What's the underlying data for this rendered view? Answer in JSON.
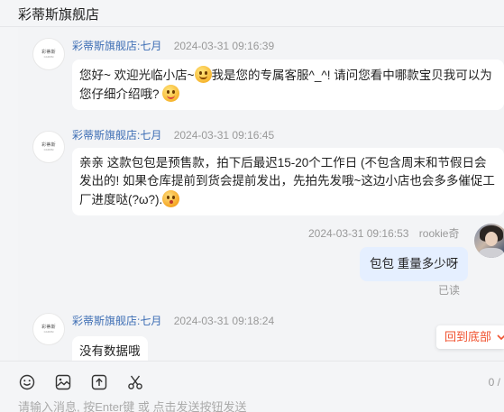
{
  "header": {
    "title": "彩蒂斯旗舰店"
  },
  "shop_avatar": {
    "logo_text": "彩蒂斯",
    "logo_sub": "CAIDISI"
  },
  "messages": [
    {
      "sender": "彩蒂斯旗舰店:七月",
      "time": "2024-03-31 09:16:39",
      "text_a": "您好~ 欢迎光临小店~",
      "text_b": "我是您的专属客服^_^! 请问您看中哪款宝贝我可以为您仔细介绍哦?",
      "emoji_a": "dizzy-face-emoji-icon",
      "emoji_b": "tongue-face-emoji-icon"
    },
    {
      "sender": "彩蒂斯旗舰店:七月",
      "time": "2024-03-31 09:16:45",
      "text": "亲亲 这款包包是预售款，拍下后最迟15-20个工作日 (不包含周末和节假日会发出的! 如果仓库提前到货会提前发出，先拍先发哦~这边小店也会多多催促工厂进度哒(?ω?).",
      "emoji": "kiss-face-emoji-icon"
    },
    {
      "sender": "rookie奇",
      "time": "2024-03-31 09:16:53",
      "text": "包包 重量多少呀",
      "status": "已读"
    },
    {
      "sender": "彩蒂斯旗舰店:七月",
      "time": "2024-03-31 09:18:24",
      "text": "没有数据哦"
    }
  ],
  "back_to_bottom": {
    "label": "回到底部",
    "icon": "chevron-down-icon"
  },
  "toolbar": {
    "icons": [
      "emoji-icon",
      "image-icon",
      "upload-icon",
      "scissors-icon"
    ],
    "counter": "0 /",
    "placeholder": "请输入消息, 按Enter键 或 点击发送按钮发送"
  },
  "colors": {
    "accent": "#f0502d",
    "sender_name": "#3f6fb5",
    "self_bubble": "#e5efff"
  }
}
